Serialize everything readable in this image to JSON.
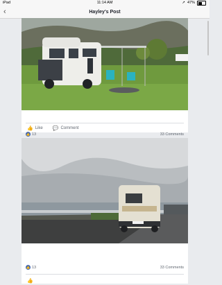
{
  "status": {
    "device": "iPad",
    "time": "11:14 AM",
    "battery": "47%",
    "battery_level": 0.47
  },
  "nav": {
    "title": "Hayley's Post",
    "back_icon": "chevron-left-icon"
  },
  "posts": [
    {
      "likes": "13",
      "comments": "33 Comments",
      "like_label": "Like",
      "comment_label": "Comment"
    },
    {
      "likes": "13",
      "comments": "33 Comments"
    }
  ],
  "colors": {
    "accent": "#4267b2",
    "background": "#e9ebee"
  }
}
